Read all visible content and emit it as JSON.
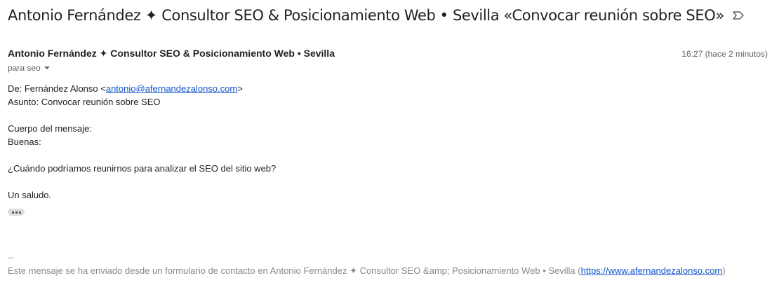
{
  "header": {
    "subject": "Antonio Fernández ✦ Consultor SEO & Posicionamiento Web • Sevilla «Convocar reunión sobre SEO»",
    "label_icon": "label-arrow-icon"
  },
  "message": {
    "sender_name": "Antonio Fernández ✦ Consultor SEO & Posicionamiento Web • Sevilla",
    "timestamp": "16:27 (hace 2 minutos)",
    "recipient": "para seo",
    "from_prefix": "De: Fernández Alonso <",
    "from_email": "antonio@afernandezalonso.com",
    "from_suffix": ">",
    "subject_line": "Asunto: Convocar reunión sobre SEO",
    "body_heading": "Cuerpo del mensaje:",
    "greeting": "Buenas:",
    "question": "¿Cuándo podríamos reunirnos para analizar el SEO del sitio web?",
    "closing": "Un saludo.",
    "show_trimmed_icon": "more-horizontal-icon"
  },
  "signature": {
    "separator": "--",
    "text_prefix": "Este mensaje se ha enviado desde un formulario de contacto en Antonio Fernández ✦ Consultor SEO &amp; Posicionamiento Web • Sevilla (",
    "url": "https://www.afernandezalonso.com",
    "text_suffix": ")"
  },
  "colors": {
    "link": "#1155cc",
    "muted": "#5f6368",
    "signature": "#888888"
  }
}
